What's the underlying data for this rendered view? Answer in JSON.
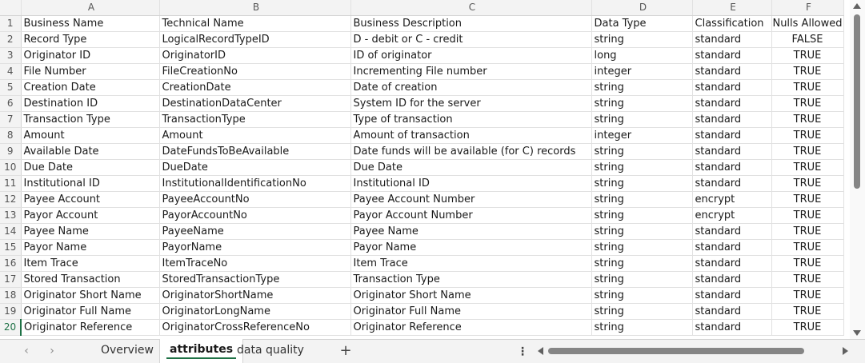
{
  "columns": [
    "A",
    "B",
    "C",
    "D",
    "E",
    "F"
  ],
  "rows": [
    {
      "num": "1",
      "cells": [
        "Business Name",
        "Technical Name",
        "Business Description",
        "Data Type",
        "Classification",
        "Nulls Allowed"
      ]
    },
    {
      "num": "2",
      "cells": [
        "Record Type",
        "LogicalRecordTypeID",
        "D - debit or C - credit",
        "string",
        "standard",
        "FALSE"
      ]
    },
    {
      "num": "3",
      "cells": [
        "Originator ID",
        "OriginatorID",
        "ID of originator",
        "long",
        "standard",
        "TRUE"
      ]
    },
    {
      "num": "4",
      "cells": [
        "File Number",
        "FileCreationNo",
        "Incrementing File number",
        "integer",
        "standard",
        "TRUE"
      ]
    },
    {
      "num": "5",
      "cells": [
        "Creation Date",
        "CreationDate",
        "Date of creation",
        "string",
        "standard",
        "TRUE"
      ]
    },
    {
      "num": "6",
      "cells": [
        "Destination ID",
        "DestinationDataCenter",
        "System ID for the server",
        "string",
        "standard",
        "TRUE"
      ]
    },
    {
      "num": "7",
      "cells": [
        "Transaction Type",
        "TransactionType",
        "Type of transaction",
        "string",
        "standard",
        "TRUE"
      ]
    },
    {
      "num": "8",
      "cells": [
        "Amount",
        "Amount",
        "Amount of transaction",
        "integer",
        "standard",
        "TRUE"
      ]
    },
    {
      "num": "9",
      "cells": [
        "Available Date",
        "DateFundsToBeAvailable",
        "Date funds will be available (for C) records",
        "string",
        "standard",
        "TRUE"
      ]
    },
    {
      "num": "10",
      "cells": [
        "Due Date",
        "DueDate",
        "Due Date",
        "string",
        "standard",
        "TRUE"
      ]
    },
    {
      "num": "11",
      "cells": [
        "Institutional ID",
        "InstitutionalIdentificationNo",
        "Institutional ID",
        "string",
        "standard",
        "TRUE"
      ]
    },
    {
      "num": "12",
      "cells": [
        "Payee Account",
        "PayeeAccountNo",
        "Payee Account Number",
        "string",
        "encrypt",
        "TRUE"
      ]
    },
    {
      "num": "13",
      "cells": [
        "Payor Account",
        "PayorAccountNo",
        "Payor Account Number",
        "string",
        "encrypt",
        "TRUE"
      ]
    },
    {
      "num": "14",
      "cells": [
        "Payee Name",
        "PayeeName",
        "Payee Name",
        "string",
        "standard",
        "TRUE"
      ]
    },
    {
      "num": "15",
      "cells": [
        "Payor Name",
        "PayorName",
        "Payor Name",
        "string",
        "standard",
        "TRUE"
      ]
    },
    {
      "num": "16",
      "cells": [
        "Item Trace",
        "ItemTraceNo",
        "Item Trace",
        "string",
        "standard",
        "TRUE"
      ]
    },
    {
      "num": "17",
      "cells": [
        "Stored Transaction",
        "StoredTransactionType",
        "Transaction Type",
        "string",
        "standard",
        "TRUE"
      ]
    },
    {
      "num": "18",
      "cells": [
        "Originator Short Name",
        "OriginatorShortName",
        "Originator Short Name",
        "string",
        "standard",
        "TRUE"
      ]
    },
    {
      "num": "19",
      "cells": [
        "Originator Full Name",
        "OriginatorLongName",
        "Originator Full Name",
        "string",
        "standard",
        "TRUE"
      ]
    },
    {
      "num": "20",
      "cells": [
        "Originator Reference",
        "OriginatorCrossReferenceNo",
        "Originator Reference",
        "string",
        "standard",
        "TRUE"
      ]
    }
  ],
  "active_row": "20",
  "sheet_tabs": [
    "Overview",
    "attributes",
    "data quality"
  ],
  "active_tab": "attributes",
  "icons": {
    "nav_prev": "chevron-left-icon",
    "nav_next": "chevron-right-icon",
    "add_sheet": "+",
    "more": "⋮"
  },
  "colors": {
    "accent": "#1e7145",
    "header_bg": "#f3f3f3",
    "gridline": "#e1e1e1"
  }
}
